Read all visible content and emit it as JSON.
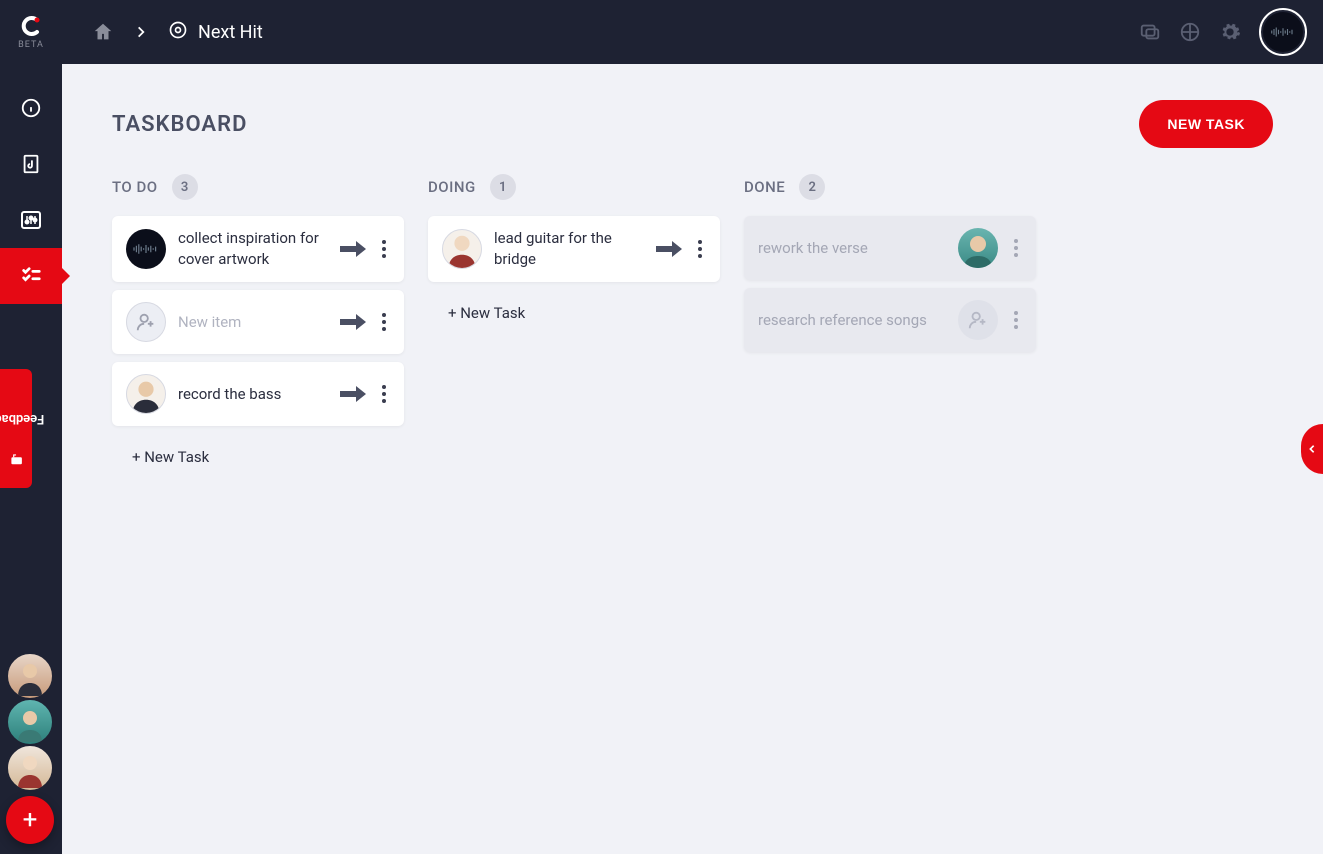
{
  "brand": {
    "beta_label": "BETA"
  },
  "breadcrumb": {
    "title": "Next Hit"
  },
  "page": {
    "title": "TASKBOARD",
    "new_task_button": "NEW TASK"
  },
  "columns": {
    "todo": {
      "title": "TO DO",
      "count": "3",
      "cards": [
        {
          "text": "collect inspiration for cover artwork",
          "avatar": "wave"
        },
        {
          "text": "New item",
          "placeholder": true,
          "avatar": "add"
        },
        {
          "text": "record the bass",
          "avatar": "person1"
        }
      ],
      "add_label": "+ New Task"
    },
    "doing": {
      "title": "DOING",
      "count": "1",
      "cards": [
        {
          "text": "lead guitar for the bridge",
          "avatar": "person2"
        }
      ],
      "add_label": "+ New Task"
    },
    "done": {
      "title": "DONE",
      "count": "2",
      "cards": [
        {
          "text": "rework the verse",
          "avatar": "person3"
        },
        {
          "text": "research reference songs",
          "avatar": "add"
        }
      ]
    }
  },
  "feedback": {
    "label": "Feedback"
  },
  "sidebar": {
    "items": [
      "info",
      "music-file",
      "mixer",
      "taskboard"
    ]
  },
  "fab": {
    "label": "+"
  }
}
